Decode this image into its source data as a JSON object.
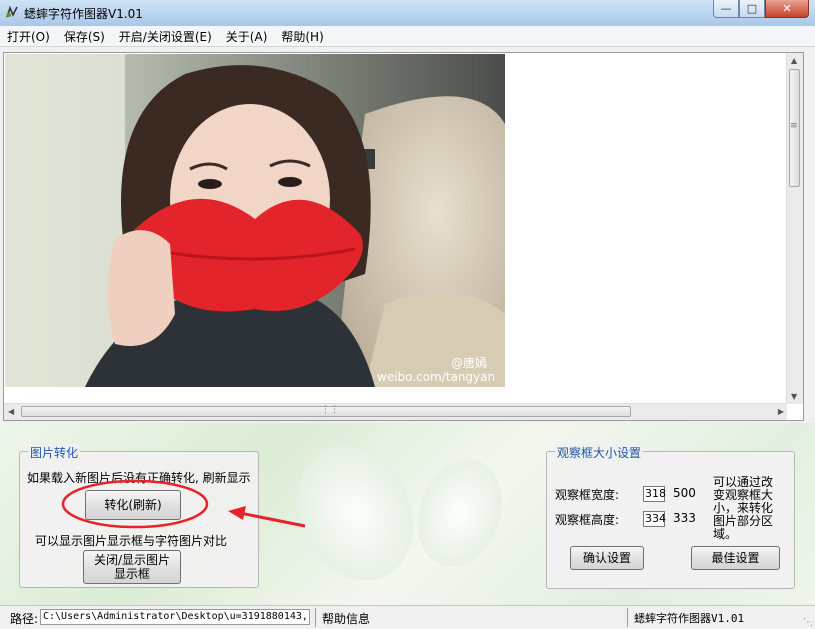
{
  "window": {
    "title": "蟋蟀字符作图器V1.01",
    "minimize_icon": "minimize-icon",
    "maximize_icon": "maximize-icon",
    "close_icon": "close-icon"
  },
  "menu": [
    {
      "label": "打开(O)"
    },
    {
      "label": "保存(S)"
    },
    {
      "label": "开启/关闭设置(E)"
    },
    {
      "label": "关于(A)"
    },
    {
      "label": "帮助(H)"
    }
  ],
  "viewport": {
    "photo_watermark_1": "@唐嫣",
    "photo_watermark_2": "weibo.com/tangyan"
  },
  "convert_group": {
    "title": "图片转化",
    "hint": "如果载入新图片后没有正确转化, 刷新显示",
    "convert_button": "转化(刷新)",
    "toggle_hint": "可以显示图片显示框与字符图片对比",
    "toggle_button_line1": "关闭/显示图片",
    "toggle_button_line2": "显示框"
  },
  "viewbox_group": {
    "title": "观察框大小设置",
    "width_label": "观察框宽度:",
    "width_value": "318",
    "width_max": "500",
    "height_label": "观察框高度:",
    "height_value": "334",
    "height_max": "333",
    "note": [
      "可以通过改",
      "变观察框大",
      "小，来转化",
      "图片部分区",
      "域。"
    ],
    "confirm_button": "确认设置",
    "best_button": "最佳设置"
  },
  "statusbar": {
    "path_label": "路径:",
    "path_value": "C:\\Users\\Administrator\\Desktop\\u=3191880143,",
    "help_label": "帮助信息",
    "app_name": "蟋蟀字符作图器V1.01"
  },
  "colors": {
    "group_title": "#1e57a5",
    "annotation": "#e8222a",
    "lips": "#e3242b"
  }
}
